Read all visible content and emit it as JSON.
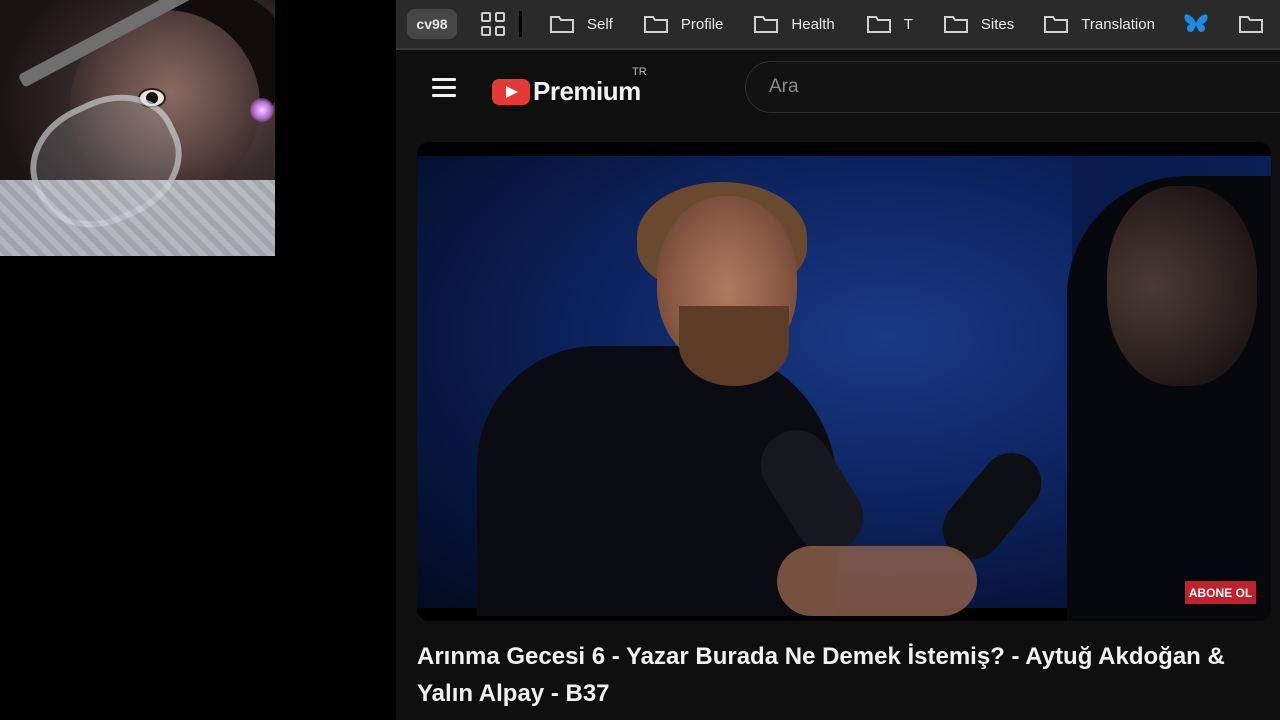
{
  "bookmarks_bar": {
    "profile": "cv98",
    "items": [
      {
        "label": "Self",
        "icon": "folder-icon"
      },
      {
        "label": "Profile",
        "icon": "folder-icon"
      },
      {
        "label": "Health",
        "icon": "folder-icon"
      },
      {
        "label": "T",
        "icon": "folder-icon"
      },
      {
        "label": "Sites",
        "icon": "folder-icon"
      },
      {
        "label": "Translation",
        "icon": "folder-icon"
      }
    ],
    "extra_icon": "butterfly-icon"
  },
  "header": {
    "logo_text": "Premium",
    "region": "TR",
    "search_placeholder": "Ara"
  },
  "video": {
    "overlay_button": "ABONE OL",
    "title": "Arınma Gecesi 6 - Yazar Burada Ne Demek İstemiş? - Aytuğ Akdoğan & Yalın Alpay - B37"
  },
  "colors": {
    "accent": "#e53935",
    "subscribe": "#c41f2c",
    "background": "#0f0f0f"
  }
}
